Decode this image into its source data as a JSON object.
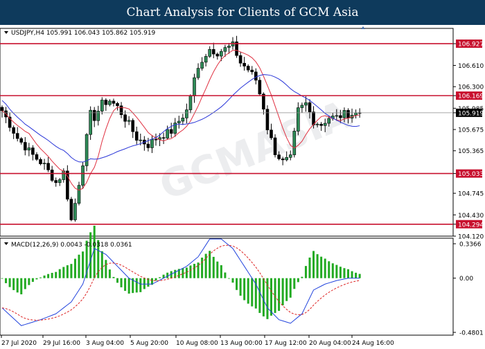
{
  "banner_title": "Chart Analysis for Clients of GCM Asia",
  "watermark": "GCMASIA",
  "price_panel": {
    "symbol_info": "USDJPY,H4  105.991 106.043 105.862 105.919",
    "axis_labels": [
      "106.927",
      "106.610",
      "106.300",
      "106.169",
      "105.985",
      "105.919",
      "105.675",
      "105.365",
      "105.033",
      "104.745",
      "104.430",
      "104.294",
      "104.120"
    ],
    "level_lines": [
      "106.927",
      "106.169",
      "105.033",
      "104.294"
    ],
    "current_price": "105.919"
  },
  "macd_panel": {
    "title": "MACD(12,26,9) 0.0043 -0.0318 0.0361",
    "axis_labels": [
      "0.3366",
      "0.00",
      "-0.4801"
    ]
  },
  "time_axis": [
    "27 Jul 2020",
    "29 Jul 16:00",
    "3 Aug 04:00",
    "5 Aug 20:00",
    "10 Aug 08:00",
    "13 Aug 00:00",
    "17 Aug 12:00",
    "20 Aug 04:00",
    "24 Aug 16:00"
  ],
  "colors": {
    "banner_bg": "#0e3a5c",
    "bull_candle": "#2e8b57",
    "bear_candle": "#000000",
    "level_line": "#c8102e",
    "ma_fast": "#e03040",
    "ma_slow": "#2a36d8",
    "macd_hist": "#22aa22",
    "macd_line": "#2244dd",
    "signal_line": "#dd2222"
  },
  "chart_data": {
    "type": "candlestick",
    "symbol": "USDJPY",
    "timeframe": "H4",
    "ylim": [
      104.12,
      107.15
    ],
    "close_path": [
      [
        0,
        105.95
      ],
      [
        4,
        105.55
      ],
      [
        8,
        105.3
      ],
      [
        11,
        105.15
      ],
      [
        14,
        104.9
      ],
      [
        16,
        105.05
      ],
      [
        18,
        104.35
      ],
      [
        19,
        104.6
      ],
      [
        21,
        105.2
      ],
      [
        23,
        105.9
      ],
      [
        24,
        105.85
      ],
      [
        26,
        106.05
      ],
      [
        28,
        106.1
      ],
      [
        30,
        106.0
      ],
      [
        33,
        105.75
      ],
      [
        35,
        105.55
      ],
      [
        38,
        105.45
      ],
      [
        40,
        105.55
      ],
      [
        42,
        105.6
      ],
      [
        44,
        105.65
      ],
      [
        46,
        105.8
      ],
      [
        48,
        105.95
      ],
      [
        50,
        106.4
      ],
      [
        52,
        106.7
      ],
      [
        54,
        106.85
      ],
      [
        56,
        106.8
      ],
      [
        58,
        106.85
      ],
      [
        60,
        106.9
      ],
      [
        62,
        106.65
      ],
      [
        64,
        106.55
      ],
      [
        66,
        106.4
      ],
      [
        68,
        106.0
      ],
      [
        69,
        105.7
      ],
      [
        71,
        105.35
      ],
      [
        73,
        105.2
      ],
      [
        75,
        105.25
      ],
      [
        77,
        105.95
      ],
      [
        79,
        106.05
      ],
      [
        81,
        105.8
      ],
      [
        83,
        105.75
      ],
      [
        85,
        105.85
      ],
      [
        87,
        105.85
      ],
      [
        89,
        105.9
      ],
      [
        91,
        105.9
      ],
      [
        93,
        105.92
      ]
    ],
    "macd_path": [
      [
        0,
        -0.25
      ],
      [
        5,
        -0.4
      ],
      [
        10,
        -0.35
      ],
      [
        14,
        -0.3
      ],
      [
        18,
        -0.2
      ],
      [
        21,
        -0.05
      ],
      [
        24,
        0.25
      ],
      [
        27,
        0.2
      ],
      [
        30,
        0.1
      ],
      [
        33,
        0.0
      ],
      [
        36,
        -0.05
      ],
      [
        39,
        -0.05
      ],
      [
        42,
        0.0
      ],
      [
        45,
        0.05
      ],
      [
        48,
        0.1
      ],
      [
        51,
        0.18
      ],
      [
        54,
        0.33
      ],
      [
        57,
        0.33
      ],
      [
        60,
        0.25
      ],
      [
        63,
        0.1
      ],
      [
        66,
        -0.05
      ],
      [
        69,
        -0.25
      ],
      [
        72,
        -0.35
      ],
      [
        75,
        -0.38
      ],
      [
        78,
        -0.3
      ],
      [
        81,
        -0.1
      ],
      [
        84,
        -0.05
      ],
      [
        87,
        -0.02
      ],
      [
        90,
        0.0
      ],
      [
        93,
        0.0
      ]
    ],
    "series": [
      {
        "name": "MACD(12,26,9)",
        "values": [
          0.0043,
          -0.0318,
          0.0361
        ]
      }
    ]
  }
}
